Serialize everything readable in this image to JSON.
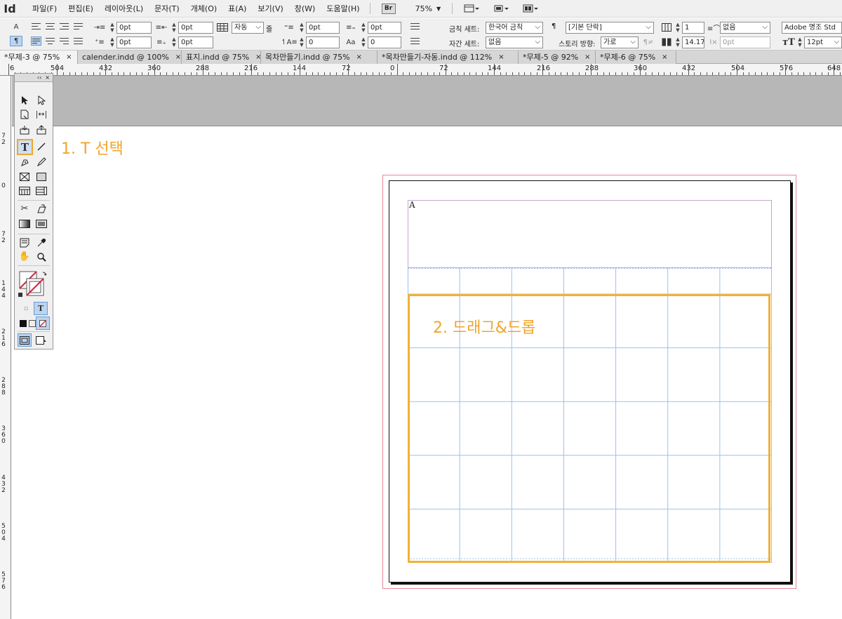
{
  "app": {
    "logo": "Id"
  },
  "menu": [
    "파일(F)",
    "편집(E)",
    "레이아웃(L)",
    "문자(T)",
    "개체(O)",
    "표(A)",
    "보기(V)",
    "창(W)",
    "도움말(H)"
  ],
  "menubar": {
    "bridge_label": "Br",
    "zoom": "75%",
    "zoom_arrow": "▼"
  },
  "control": {
    "char_toggle": "A",
    "para_toggle": "¶",
    "indent_left": "0pt",
    "indent_first": "0pt",
    "indent_right": "0pt",
    "indent_last": "0pt",
    "space_before": "0pt",
    "space_after": "0pt",
    "drop_lines": "0",
    "drop_chars": "0",
    "grid_mode": "자동",
    "grid_unit": "줄",
    "kinsoku_label": "금칙 세트:",
    "kinsoku_value": "한국어 금칙",
    "mojikumi_label": "자간 세트:",
    "mojikumi_value": "없음",
    "para_style": "[기본 단락]",
    "story_dir_label": "스토리 방향:",
    "story_dir_value": "가로",
    "columns": "1",
    "gutter": "14.17",
    "span": "없음",
    "bullet_indent": "0pt",
    "font_family": "Adobe 명조 Std",
    "font_size": "12pt",
    "pilcrow": "¶"
  },
  "tabs": [
    {
      "label": "*무제-3 @ 75%",
      "active": true
    },
    {
      "label": "calender.indd @ 100%",
      "active": false
    },
    {
      "label": "표지.indd @ 75%",
      "active": false
    },
    {
      "label": "목차만들기.indd @ 75%",
      "active": false
    },
    {
      "label": "*목차만들기-자동.indd @ 112%",
      "active": false
    },
    {
      "label": "*무제-5 @ 92%",
      "active": false
    },
    {
      "label": "*무제-6 @ 75%",
      "active": false
    }
  ],
  "tab_close": "×",
  "ruler": {
    "h_labels": [
      "6",
      "504",
      "432",
      "360",
      "288",
      "216",
      "144",
      "72",
      "0",
      "72",
      "144",
      "216",
      "288",
      "360",
      "432",
      "504",
      "576",
      "648"
    ],
    "v_labels": [
      "7",
      "2",
      "0",
      "7",
      "2",
      "1",
      "4",
      "4",
      "2",
      "1",
      "6",
      "2",
      "8",
      "8",
      "3",
      "6",
      "0",
      "4",
      "3",
      "2",
      "5",
      "0",
      "4",
      "5",
      "7",
      "6"
    ]
  },
  "tools_panel": {
    "collapse": "‹‹",
    "close": "×"
  },
  "document": {
    "frame_label": "A"
  },
  "table": {
    "header_cols": 7,
    "body_cols": 7,
    "body_rows": 5
  },
  "annotations": {
    "step1": "1. T 선택",
    "step2": "2. 드래그&드롭",
    "accent_color": "#f1a72a"
  }
}
